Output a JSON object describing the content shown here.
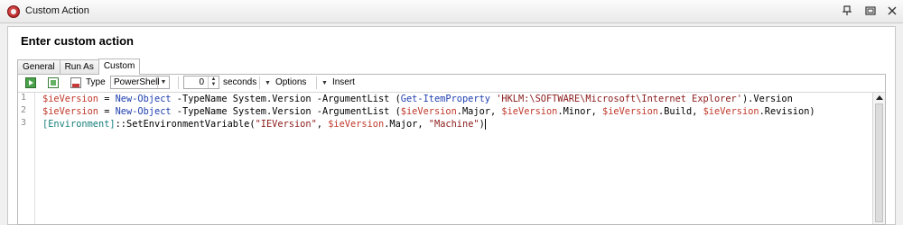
{
  "window": {
    "title": "Custom Action"
  },
  "dialog": {
    "heading": "Enter custom action"
  },
  "tabs": [
    {
      "label": "General",
      "active": false
    },
    {
      "label": "Run As",
      "active": false
    },
    {
      "label": "Custom",
      "active": true
    }
  ],
  "toolbar": {
    "run_icon": "run-script-icon",
    "copy_icon": "copy-icon",
    "doc_icon": "document-icon",
    "type_label": "Type",
    "type_value": "PowerShell",
    "timeout_value": "0",
    "seconds_label": "seconds",
    "options_label": "Options",
    "insert_label": "Insert"
  },
  "editor": {
    "line_numbers": [
      "1",
      "2",
      "3"
    ],
    "lines": [
      [
        {
          "t": "var",
          "v": "$ieVersion"
        },
        {
          "t": "txt",
          "v": " = "
        },
        {
          "t": "cmd",
          "v": "New-Object"
        },
        {
          "t": "txt",
          "v": " -TypeName System.Version -ArgumentList ("
        },
        {
          "t": "cmd",
          "v": "Get-ItemProperty"
        },
        {
          "t": "txt",
          "v": " "
        },
        {
          "t": "str",
          "v": "'HKLM:\\SOFTWARE\\Microsoft\\Internet Explorer'"
        },
        {
          "t": "txt",
          "v": ").Version"
        }
      ],
      [
        {
          "t": "var",
          "v": "$ieVersion"
        },
        {
          "t": "txt",
          "v": " = "
        },
        {
          "t": "cmd",
          "v": "New-Object"
        },
        {
          "t": "txt",
          "v": " -TypeName System.Version -ArgumentList ("
        },
        {
          "t": "var",
          "v": "$ieVersion"
        },
        {
          "t": "txt",
          "v": ".Major, "
        },
        {
          "t": "var",
          "v": "$ieVersion"
        },
        {
          "t": "txt",
          "v": ".Minor, "
        },
        {
          "t": "var",
          "v": "$ieVersion"
        },
        {
          "t": "txt",
          "v": ".Build, "
        },
        {
          "t": "var",
          "v": "$ieVersion"
        },
        {
          "t": "txt",
          "v": ".Revision)"
        }
      ],
      [
        {
          "t": "typ",
          "v": "[Environment]"
        },
        {
          "t": "txt",
          "v": "::SetEnvironmentVariable("
        },
        {
          "t": "str",
          "v": "\"IEVersion\""
        },
        {
          "t": "txt",
          "v": ", "
        },
        {
          "t": "var",
          "v": "$ieVersion"
        },
        {
          "t": "txt",
          "v": ".Major, "
        },
        {
          "t": "str",
          "v": "\"Machine\""
        },
        {
          "t": "txt",
          "v": ")"
        }
      ]
    ]
  },
  "colors": {
    "variable": "#c0392b",
    "cmdlet": "#1f3fb0",
    "string": "#8b1a1a",
    "type": "#17807a"
  }
}
